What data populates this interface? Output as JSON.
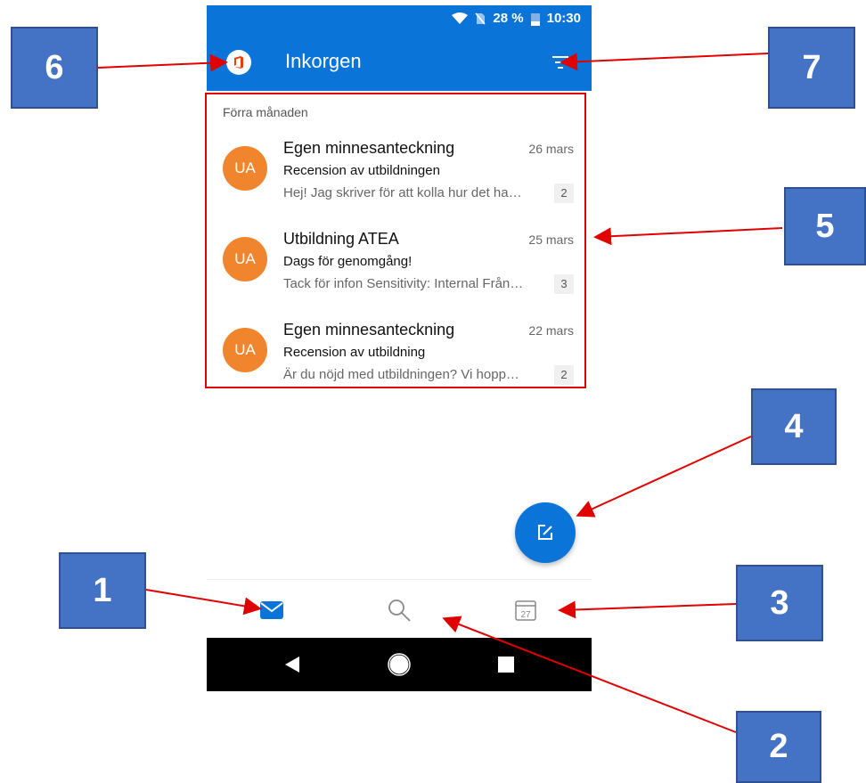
{
  "status_bar": {
    "battery": "28 %",
    "time": "10:30"
  },
  "app_bar": {
    "title": "Inkorgen",
    "logo_icon": "office-icon",
    "filter_icon": "filter-icon"
  },
  "inbox": {
    "section_title": "Förra månaden",
    "messages": [
      {
        "avatar": "UA",
        "sender": "Egen minnesanteckning",
        "date": "26 mars",
        "subject": "Recension av utbildningen",
        "preview": "Hej! Jag skriver för att kolla hur det ha…",
        "count": "2"
      },
      {
        "avatar": "UA",
        "sender": "Utbildning ATEA",
        "date": "25 mars",
        "subject": "Dags för genomgång!",
        "preview": "Tack för infon Sensitivity: Internal Från…",
        "count": "3"
      },
      {
        "avatar": "UA",
        "sender": "Egen minnesanteckning",
        "date": "22 mars",
        "subject": "Recension av utbildning",
        "preview": "Är du nöjd med utbildningen? Vi hopp…",
        "count": "2"
      }
    ]
  },
  "bottom_nav": {
    "mail_icon": "mail-icon",
    "search_icon": "search-icon",
    "calendar_day": "27"
  },
  "callouts": {
    "c1": "1",
    "c2": "2",
    "c3": "3",
    "c4": "4",
    "c5": "5",
    "c6": "6",
    "c7": "7"
  },
  "colors": {
    "accent": "#0a74d8",
    "avatar": "#f0852d",
    "callout": "#4472c4",
    "arrow": "#e00000"
  }
}
